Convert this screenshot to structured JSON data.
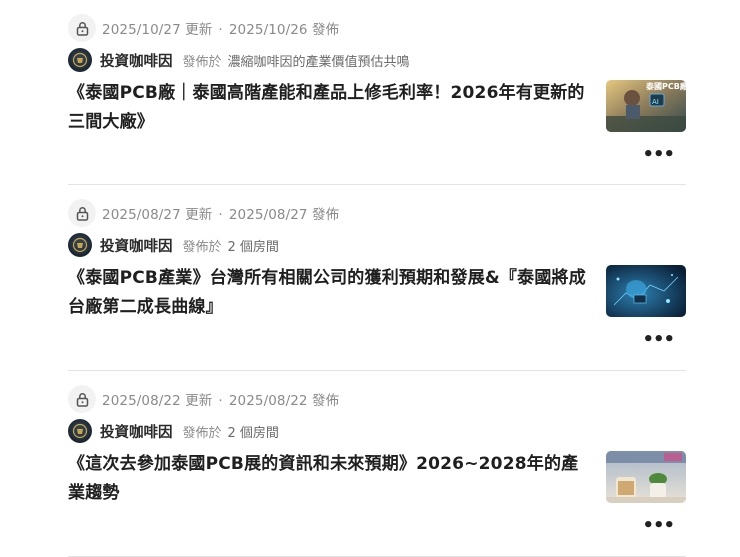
{
  "posts": [
    {
      "updated": "2025/10/27 更新",
      "published": "2025/10/26 發佈",
      "author": "投資咖啡因",
      "posted_in": "發佈於",
      "room": "濃縮咖啡因的產業價值預估共鳴",
      "title": "《泰國PCB廠｜泰國高階產能和產品上修毛利率！2026年有更新的三間大廠》",
      "thumb_text": "泰國PCB廠",
      "more": "•••"
    },
    {
      "updated": "2025/08/27 更新",
      "published": "2025/08/27 發佈",
      "author": "投資咖啡因",
      "posted_in": "發佈於",
      "room": "2 個房間",
      "title": "《泰國PCB產業》台灣所有相關公司的獲利預期和發展&『泰國將成台廠第二成長曲線』",
      "more": "•••"
    },
    {
      "updated": "2025/08/22 更新",
      "published": "2025/08/22 發佈",
      "author": "投資咖啡因",
      "posted_in": "發佈於",
      "room": "2 個房間",
      "title": "《這次去參加泰國PCB展的資訊和未來預期》2026~2028年的產業趨勢",
      "more": "•••"
    }
  ],
  "separator": "·"
}
